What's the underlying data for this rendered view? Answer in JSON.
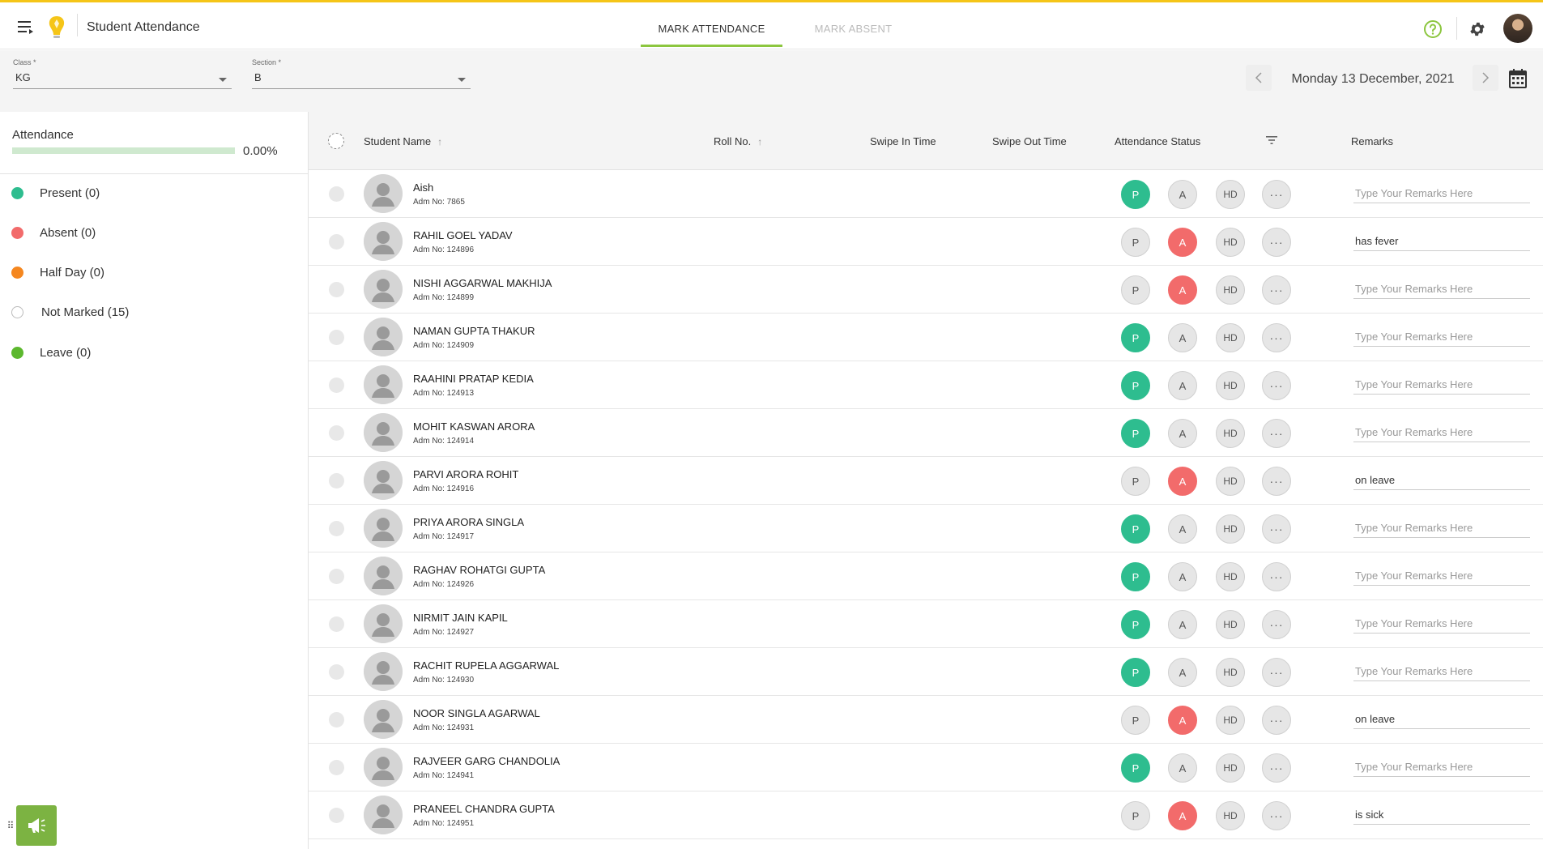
{
  "header": {
    "page_title": "Student Attendance",
    "tabs": [
      "MARK ATTENDANCE",
      "MARK ABSENT"
    ],
    "active_tab": "MARK ATTENDANCE",
    "icons": [
      "menu-icon",
      "logo-icon",
      "help-icon",
      "gear-icon",
      "avatar"
    ]
  },
  "filters": {
    "class_label": "Class *",
    "class_value": "KG",
    "section_label": "Section *",
    "section_value": "B",
    "date": "Monday 13 December, 2021"
  },
  "sidebar": {
    "attendance_label": "Attendance",
    "attendance_pct": "0.00%",
    "legend": [
      {
        "label": "Present (0)",
        "color": "#2ebd8f"
      },
      {
        "label": "Absent (0)",
        "color": "#f26b6b"
      },
      {
        "label": "Half Day (0)",
        "color": "#f5871f"
      },
      {
        "label": "Not Marked (15)",
        "color": "#ffffff"
      },
      {
        "label": "Leave (0)",
        "color": "#5cb82e"
      }
    ]
  },
  "table": {
    "columns": {
      "name": "Student Name",
      "roll": "Roll No.",
      "swipe_in": "Swipe In Time",
      "swipe_out": "Swipe Out Time",
      "status": "Attendance Status",
      "remarks": "Remarks"
    },
    "status_labels": {
      "p": "P",
      "a": "A",
      "hd": "HD",
      "more": "···"
    },
    "remarks_placeholder": "Type Your Remarks Here",
    "rows": [
      {
        "name": "Aish",
        "adm": "Adm No: 7865",
        "status": "P",
        "remark": ""
      },
      {
        "name": "RAHIL GOEL YADAV",
        "adm": "Adm No: 124896",
        "status": "A",
        "remark": "has fever"
      },
      {
        "name": "NISHI AGGARWAL MAKHIJA",
        "adm": "Adm No: 124899",
        "status": "A",
        "remark": ""
      },
      {
        "name": "NAMAN GUPTA THAKUR",
        "adm": "Adm No: 124909",
        "status": "P",
        "remark": ""
      },
      {
        "name": "RAAHINI PRATAP KEDIA",
        "adm": "Adm No: 124913",
        "status": "P",
        "remark": ""
      },
      {
        "name": "MOHIT KASWAN ARORA",
        "adm": "Adm No: 124914",
        "status": "P",
        "remark": ""
      },
      {
        "name": "PARVI ARORA ROHIT",
        "adm": "Adm No: 124916",
        "status": "A",
        "remark": "on leave"
      },
      {
        "name": "PRIYA ARORA SINGLA",
        "adm": "Adm No: 124917",
        "status": "P",
        "remark": ""
      },
      {
        "name": "RAGHAV ROHATGI GUPTA",
        "adm": "Adm No: 124926",
        "status": "P",
        "remark": ""
      },
      {
        "name": "NIRMIT JAIN KAPIL",
        "adm": "Adm No: 124927",
        "status": "P",
        "remark": ""
      },
      {
        "name": "RACHIT RUPELA AGGARWAL",
        "adm": "Adm No: 124930",
        "status": "P",
        "remark": ""
      },
      {
        "name": "NOOR SINGLA AGARWAL",
        "adm": "Adm No: 124931",
        "status": "A",
        "remark": "on leave"
      },
      {
        "name": "RAJVEER GARG CHANDOLIA",
        "adm": "Adm No: 124941",
        "status": "P",
        "remark": ""
      },
      {
        "name": "PRANEEL CHANDRA GUPTA",
        "adm": "Adm No: 124951",
        "status": "A",
        "remark": "is sick"
      }
    ]
  }
}
